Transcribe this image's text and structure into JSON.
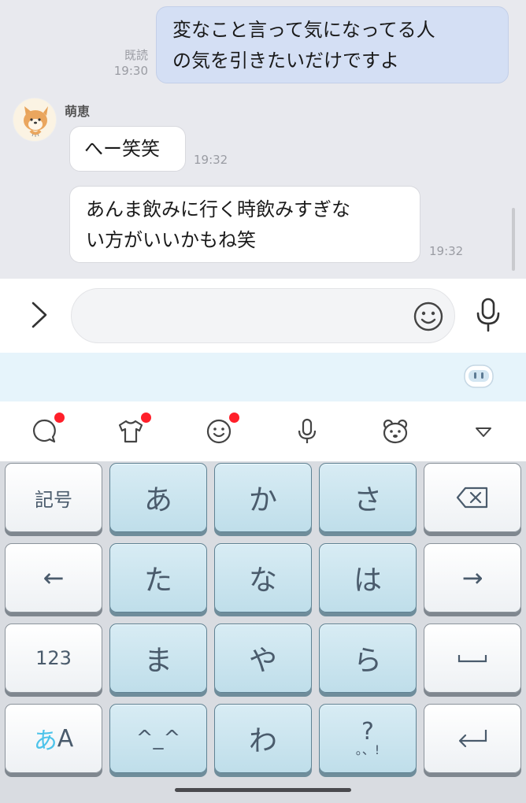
{
  "chat": {
    "outgoing": {
      "line1": "変なこと言って気になってる人",
      "line2": "の気を引きたいだけですよ",
      "read_label": "既読",
      "time": "19:30"
    },
    "contact_name": "萌恵",
    "incoming": [
      {
        "line1": "へー笑笑",
        "line2": "",
        "time": "19:32"
      },
      {
        "line1": "あんま飲みに行く時飲みすぎな",
        "line2": "い方がいいかもね笑",
        "time": "19:32"
      }
    ]
  },
  "input": {
    "placeholder": ""
  },
  "keyboard": {
    "keys": {
      "symbols": "記号",
      "a": "あ",
      "ka": "か",
      "sa": "さ",
      "left": "←",
      "ta": "た",
      "na": "な",
      "ha": "は",
      "right": "→",
      "numbers": "123",
      "ma": "ま",
      "ya": "や",
      "ra": "ら",
      "mode_kana": "あ",
      "mode_latin": "A",
      "kaomoji": "^_^",
      "wa": "わ",
      "punct_top": "?",
      "punct_bottom": "。、!"
    }
  },
  "colors": {
    "outgoing_bubble": "#d4dff4",
    "incoming_bubble": "#ffffff",
    "blue_key": "#c8e4ef",
    "notification_dot": "#ff1f2a",
    "suggestion_strip": "#e6f4fb"
  }
}
